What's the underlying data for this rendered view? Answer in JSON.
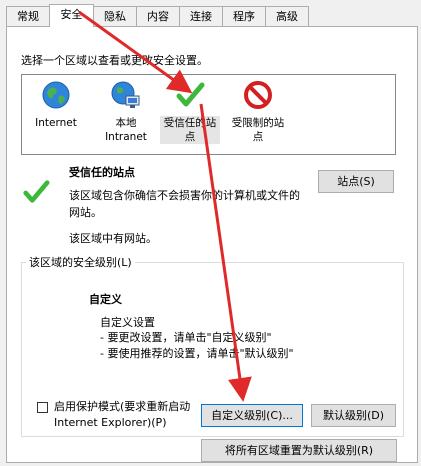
{
  "tabs": [
    {
      "label": "常规",
      "active": false
    },
    {
      "label": "安全",
      "active": true
    },
    {
      "label": "隐私",
      "active": false
    },
    {
      "label": "内容",
      "active": false
    },
    {
      "label": "连接",
      "active": false
    },
    {
      "label": "程序",
      "active": false
    },
    {
      "label": "高级",
      "active": false
    }
  ],
  "instruction": "选择一个区域以查看或更改安全设置。",
  "zones": [
    {
      "label": "Internet",
      "icon": "globe-icon",
      "selected": false
    },
    {
      "label": "本地\nIntranet",
      "icon": "intranet-icon",
      "selected": false
    },
    {
      "label": "受信任的站\n点",
      "icon": "trusted-check-icon",
      "selected": true
    },
    {
      "label": "受限制的站\n点",
      "icon": "restricted-icon",
      "selected": false
    }
  ],
  "zone_detail": {
    "title": "受信任的站点",
    "description": "该区域包含你确信不会损害你的计算机或文件的网站。",
    "has_sites": "该区域中有网站。",
    "sites_button": "站点(S)"
  },
  "security_level": {
    "group_label": "该区域的安全级别(L)",
    "level_name": "自定义",
    "line1": "自定义设置",
    "line2": "- 要更改设置，请单击\"自定义级别\"",
    "line3": "- 要使用推荐的设置，请单击\"默认级别\"",
    "protected_mode_line1": "启用保护模式(要求重新启动",
    "protected_mode_line2": "Internet Explorer)(P)",
    "protected_mode_checked": false,
    "custom_level_button": "自定义级别(C)...",
    "default_level_button": "默认级别(D)"
  },
  "reset_all_button": "将所有区域重置为默认级别(R)",
  "colors": {
    "annotation_arrow": "#e02a2a",
    "check_green": "#3cb83c",
    "restricted_red": "#d32020"
  }
}
